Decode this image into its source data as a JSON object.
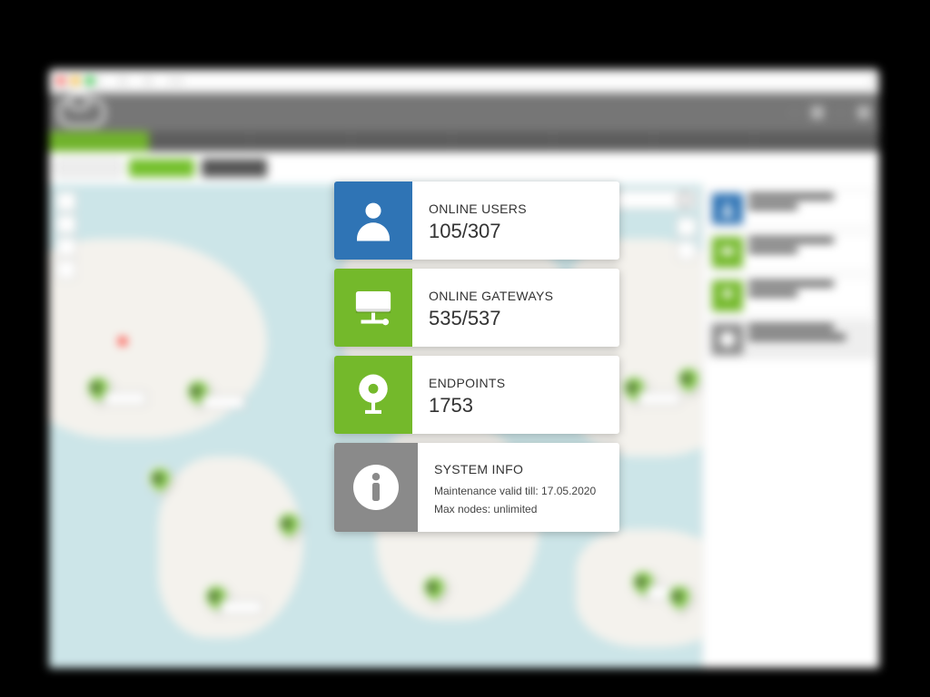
{
  "cards": {
    "users": {
      "title": "ONLINE USERS",
      "value": "105/307"
    },
    "gateways": {
      "title": "ONLINE GATEWAYS",
      "value": "535/537"
    },
    "endpoints": {
      "title": "ENDPOINTS",
      "value": "1753"
    },
    "sysinfo": {
      "title": "SYSTEM INFO",
      "line1": "Maintenance valid till: 17.05.2020",
      "line2": "Max nodes: unlimited"
    }
  },
  "colors": {
    "blue": "#2f74b5",
    "green": "#74b92b",
    "gray": "#8a8a8a"
  }
}
